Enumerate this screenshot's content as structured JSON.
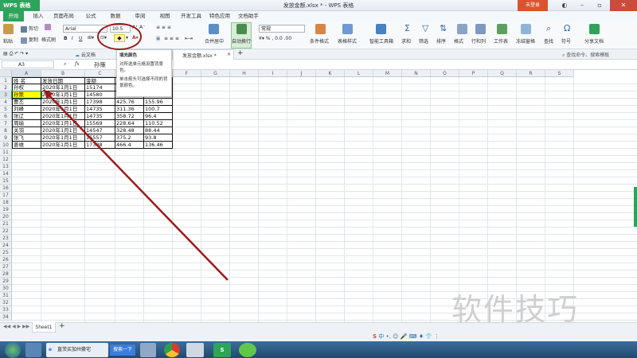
{
  "app": {
    "name": "WPS 表格",
    "window_title": "发放金额.xlsx * - WPS 表格",
    "login_label": "未登录"
  },
  "menu": [
    "开始",
    "插入",
    "页面布局",
    "公式",
    "数据",
    "审阅",
    "视图",
    "开发工具",
    "特色应用",
    "文档助手"
  ],
  "ribbon": {
    "paste": "粘贴",
    "cut": "剪切",
    "copy": "复制",
    "format_painter": "格式刷",
    "font_name": "Arial",
    "font_size": "10.5",
    "merge": "合并居中",
    "wrap": "自动换行",
    "number_format": "常规",
    "cond_format": "条件格式",
    "table_style": "表格样式",
    "toolbox": "智能工具箱",
    "sum": "求和",
    "filter": "筛选",
    "sort": "排序",
    "format": "格式",
    "rowcol": "行和列",
    "worksheet": "工作表",
    "freeze": "冻结窗格",
    "find": "查找",
    "symbol": "符号",
    "share": "分享文档"
  },
  "tabs": {
    "cloud": "云文档",
    "file_tab": "发放金额.xlsx *",
    "search_cmd": "查找命令、搜索模板"
  },
  "formula": {
    "cell_ref": "A3",
    "fx": "fx",
    "value": "孙策"
  },
  "tooltip": {
    "title": "填充颜色",
    "line1": "对所选单元格设置背景色。",
    "line2": "单击箭头可选择不同的背景颜色。"
  },
  "grid": {
    "columns": [
      "A",
      "B",
      "C",
      "D",
      "E",
      "F",
      "G",
      "H",
      "I",
      "J",
      "K",
      "L",
      "M",
      "N",
      "O",
      "P",
      "Q",
      "R",
      "S"
    ],
    "row_numbers": [
      "1",
      "2",
      "3",
      "4",
      "5",
      "6",
      "7",
      "8",
      "9",
      "10",
      "11",
      "12",
      "13",
      "14",
      "15",
      "16",
      "17",
      "18",
      "19",
      "20",
      "21",
      "22",
      "23",
      "24",
      "25",
      "26",
      "27",
      "28",
      "29",
      "30",
      "31",
      "32",
      "33",
      "34"
    ],
    "rows": [
      [
        "姓 名",
        "发放日期",
        "金额",
        "",
        ""
      ],
      [
        "孙权",
        "2020年1月1日",
        "15174",
        "",
        ""
      ],
      [
        "孙策",
        "2020年1月1日",
        "14580",
        "",
        ""
      ],
      [
        "曹丕",
        "2020年1月1日",
        "17398",
        "425.76",
        "155.96"
      ],
      [
        "刘峰",
        "2020年1月1日",
        "14735",
        "311.36",
        "100.7"
      ],
      [
        "张辽",
        "2020年1月1日",
        "14735",
        "358.72",
        "96.4"
      ],
      [
        "周瑜",
        "2020年1月1日",
        "15569",
        "228.64",
        "110.52"
      ],
      [
        "关羽",
        "2020年1月1日",
        "14547",
        "328.48",
        "88.44"
      ],
      [
        "张飞",
        "2020年1月1日",
        "15557",
        "375.2",
        "93.8"
      ],
      [
        "姜维",
        "2020年1月1日",
        "17398",
        "466.4",
        "136.46"
      ]
    ]
  },
  "sheets": [
    "Sheet1"
  ],
  "taskbar": {
    "ie_tab": "直茨买加州豪宅",
    "search_btn": "搜索一下"
  },
  "watermark": "软件技巧",
  "colors": {
    "accent": "#2ea35b",
    "highlight": "#ffff00",
    "annotation": "#9b1b1b"
  }
}
